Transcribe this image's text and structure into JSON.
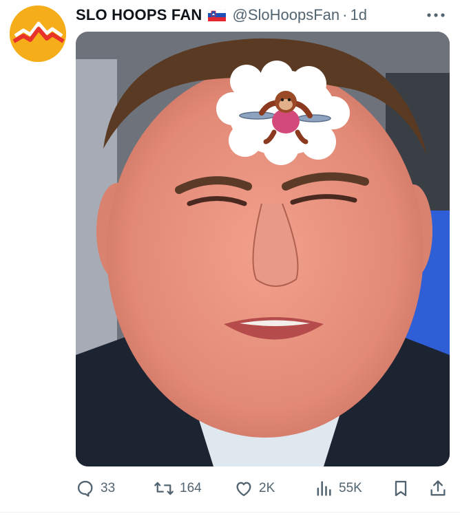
{
  "post": {
    "display_name": "SLO HOOPS FAN",
    "flag": "slovenia-flag",
    "handle": "@SloHoopsFan",
    "separator": "·",
    "time": "1d"
  },
  "media": {
    "description_icon": "monkey-thought-bubble"
  },
  "actions": {
    "replies": "33",
    "reposts": "164",
    "likes": "2K",
    "views": "55K"
  },
  "colors": {
    "avatar_bg": "#f6ad1a",
    "avatar_logo": "#e8332b",
    "text_primary": "#0f1419",
    "text_secondary": "#536471"
  }
}
